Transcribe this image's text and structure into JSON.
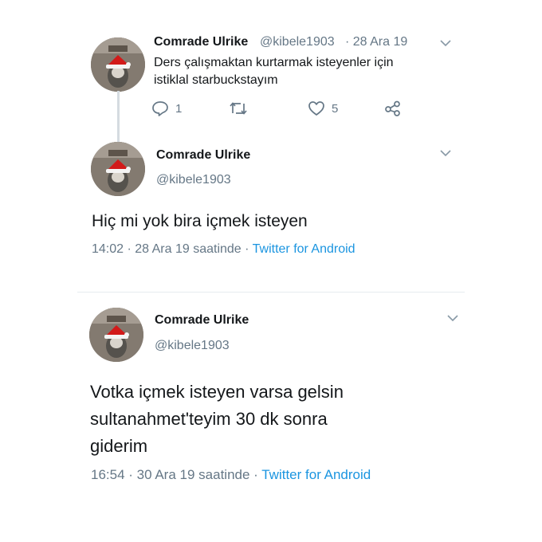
{
  "tweet1": {
    "name": "Comrade Ulrike",
    "handle": "@kibele1903",
    "date": "· 28 Ara 19",
    "text_line1": "Ders çalışmaktan kurtarmak isteyenler için",
    "text_line2": "istiklal starbuckstayım",
    "actions": {
      "reply_count": "1",
      "retweet_count": "",
      "like_count": "5"
    },
    "icons": [
      "chevron-down-icon",
      "reply-icon",
      "retweet-icon",
      "like-icon",
      "share-icon"
    ]
  },
  "tweet2": {
    "name": "Comrade Ulrike",
    "handle": "@kibele1903",
    "text": "Hiç mi yok bira içmek isteyen",
    "meta": "14:02 · 28 Ara 19 saatinde · ",
    "source": "Twitter for Android"
  },
  "tweet3": {
    "name": "Comrade Ulrike",
    "handle": "@kibele1903",
    "text_line1": "Votka içmek isteyen varsa gelsin",
    "text_line2": "sultanahmet'teyim 30 dk sonra",
    "text_line3": "giderim",
    "meta": "16:54 · 30 Ara 19 saatinde · ",
    "source": "Twitter for Android"
  },
  "colors": {
    "text": "#14171a",
    "secondary": "#657786",
    "link": "#1b95e0",
    "thread_line": "#d5dbe0"
  }
}
